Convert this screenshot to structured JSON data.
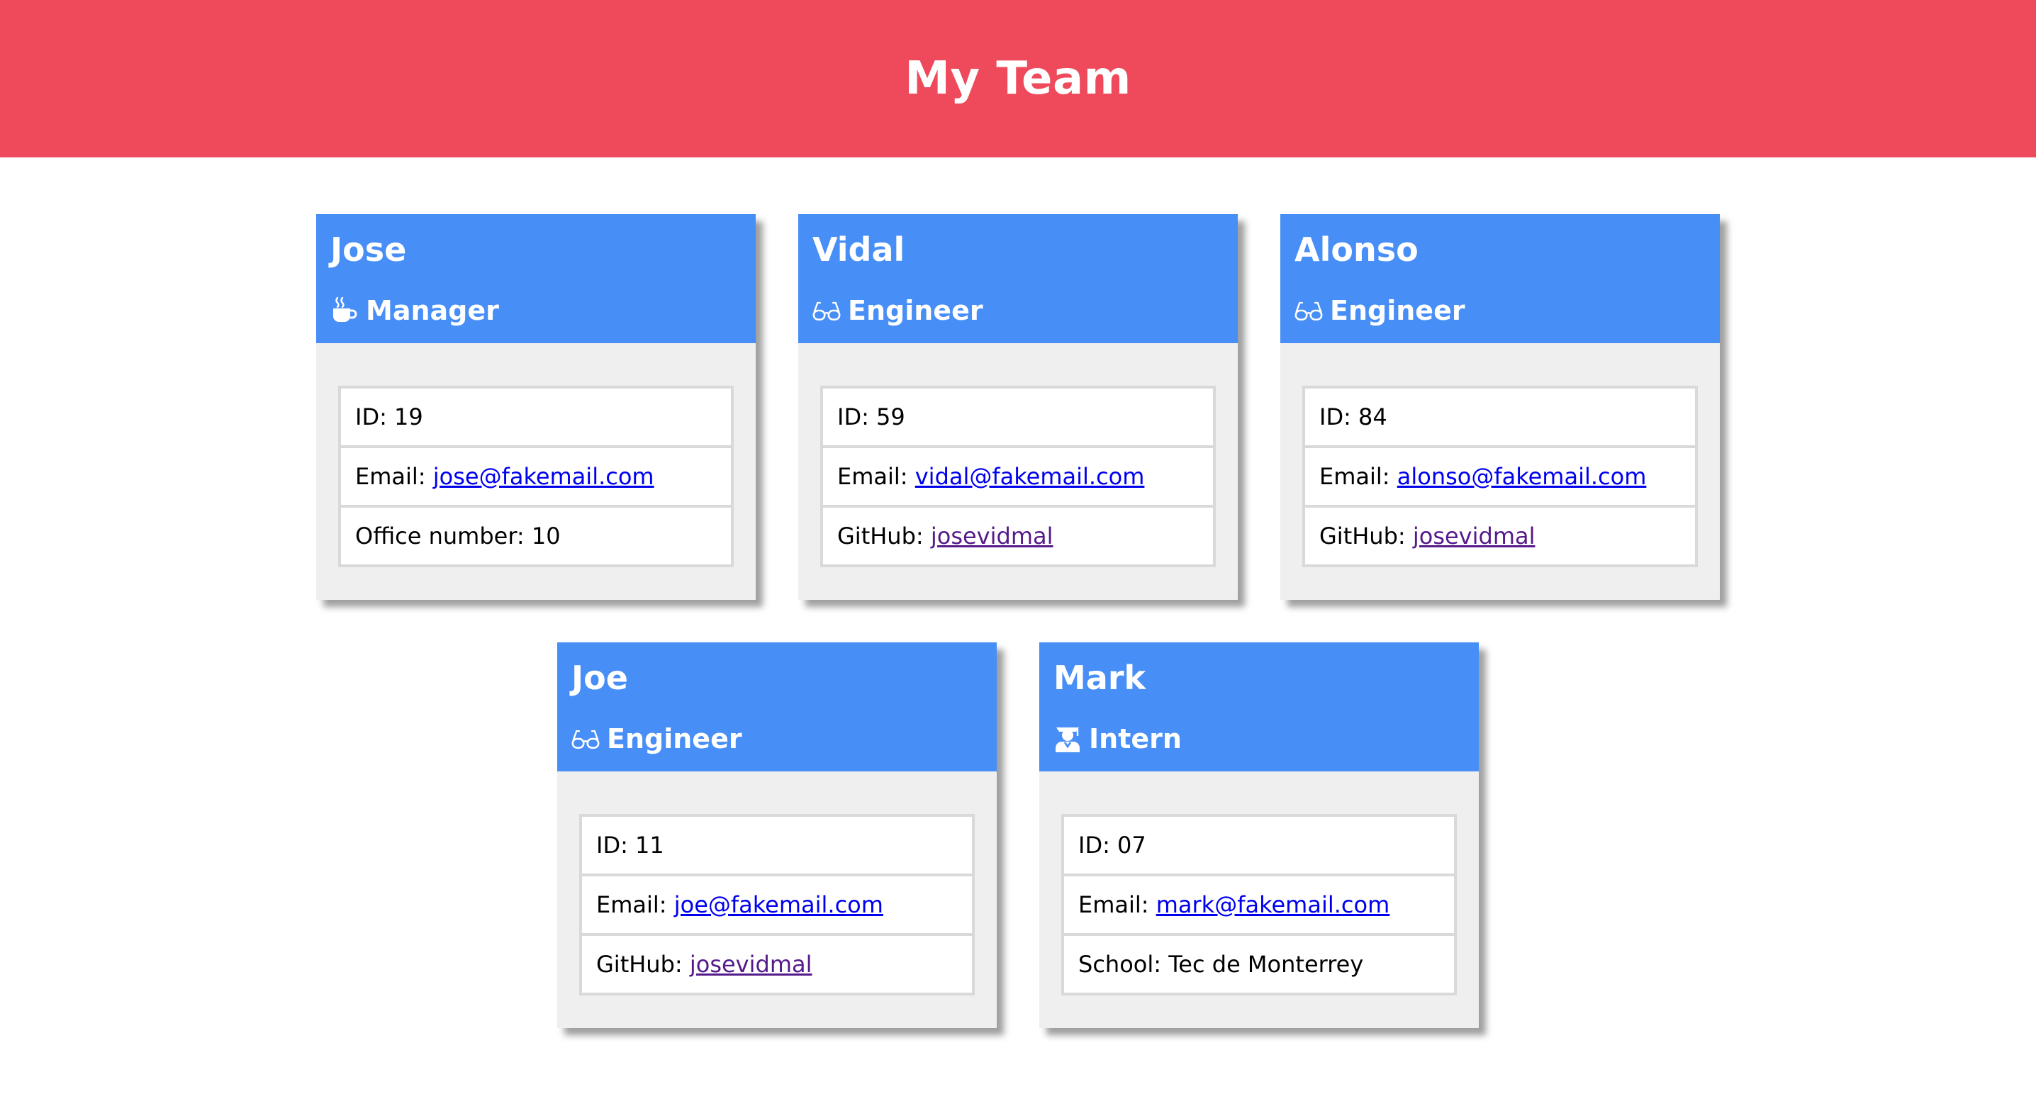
{
  "header": {
    "title": "My Team"
  },
  "cards": [
    {
      "name": "Jose",
      "role": "Manager",
      "role_icon": "coffee-mug-icon",
      "id_label": "ID: ",
      "id": "19",
      "email_label": "Email: ",
      "email": "jose@fakemail.com",
      "extra_label": "Office number: ",
      "extra_value": "10"
    },
    {
      "name": "Vidal",
      "role": "Engineer",
      "role_icon": "glasses-icon",
      "id_label": "ID: ",
      "id": "59",
      "email_label": "Email: ",
      "email": "vidal@fakemail.com",
      "extra_label": "GitHub: ",
      "extra_value": "josevidmal"
    },
    {
      "name": "Alonso",
      "role": "Engineer",
      "role_icon": "glasses-icon",
      "id_label": "ID: ",
      "id": "84",
      "email_label": "Email: ",
      "email": "alonso@fakemail.com",
      "extra_label": "GitHub: ",
      "extra_value": "josevidmal"
    },
    {
      "name": "Joe",
      "role": "Engineer",
      "role_icon": "glasses-icon",
      "id_label": "ID: ",
      "id": "11",
      "email_label": "Email: ",
      "email": "joe@fakemail.com",
      "extra_label": "GitHub: ",
      "extra_value": "josevidmal"
    },
    {
      "name": "Mark",
      "role": "Intern",
      "role_icon": "graduate-icon",
      "id_label": "ID: ",
      "id": "07",
      "email_label": "Email: ",
      "email": "mark@fakemail.com",
      "extra_label": "School: ",
      "extra_value": "Tec de Monterrey"
    }
  ],
  "colors": {
    "header_bg": "#ee4a5b",
    "card_head_bg": "#478ef6",
    "card_body_bg": "#efefef",
    "email_link": "#0000ee",
    "github_link": "#551a8b"
  }
}
